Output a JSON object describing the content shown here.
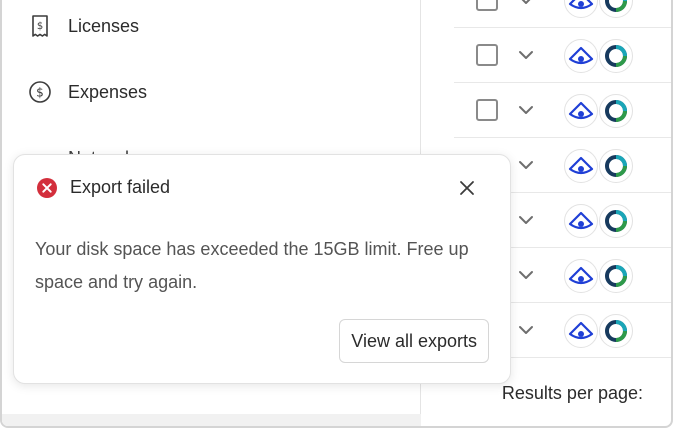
{
  "sidebar": {
    "items": [
      {
        "label": "Licenses",
        "icon": "receipt-dollar-icon"
      },
      {
        "label": "Expenses",
        "icon": "dollar-circle-icon"
      },
      {
        "label": "Network",
        "icon": "network-icon"
      }
    ]
  },
  "table": {
    "rows": 7
  },
  "footer": {
    "results_per_page_label": "Results per page:"
  },
  "toast": {
    "title": "Export failed",
    "message": "Your disk space has exceeded the 15GB limit. Free up space and try again.",
    "button_label": "View all exports",
    "icon": "error-circle-icon",
    "error_color": "#d32f3c"
  },
  "colors": {
    "app_eye": "#1f3fd6",
    "app_ring_teal": "#1aa6b8",
    "app_ring_green": "#2e9a4a",
    "app_ring_navy": "#173a5e"
  }
}
